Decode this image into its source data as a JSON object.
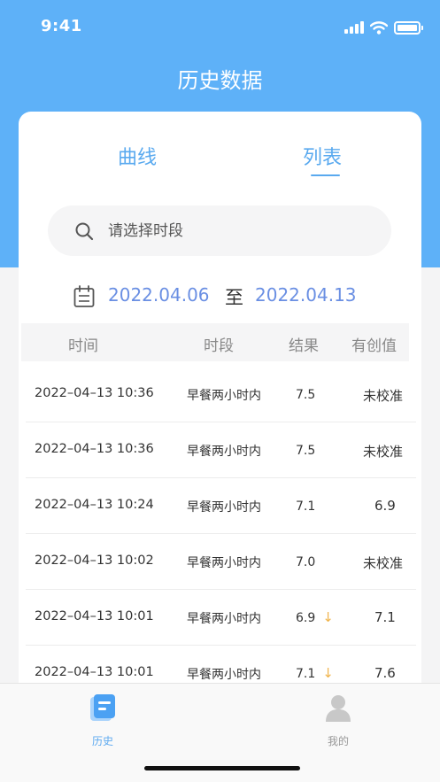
{
  "status_bar": {
    "time": "9:41"
  },
  "header": {
    "title": "历史数据"
  },
  "tabs": {
    "curve": "曲线",
    "list": "列表",
    "active": "列表"
  },
  "search": {
    "placeholder": "请选择时段"
  },
  "date_range": {
    "start": "2022.04.06",
    "separator": "至",
    "end": "2022.04.13"
  },
  "table": {
    "headers": {
      "time": "时间",
      "period": "时段",
      "result": "结果",
      "calibration": "有创值"
    },
    "rows": [
      {
        "time": "2022–04–13 10:36",
        "period": "早餐两小时内",
        "result": "7.5",
        "trend": "",
        "calibration": "未校准"
      },
      {
        "time": "2022–04–13 10:36",
        "period": "早餐两小时内",
        "result": "7.5",
        "trend": "",
        "calibration": "未校准"
      },
      {
        "time": "2022–04–13 10:24",
        "period": "早餐两小时内",
        "result": "7.1",
        "trend": "",
        "calibration": "6.9"
      },
      {
        "time": "2022–04–13 10:02",
        "period": "早餐两小时内",
        "result": "7.0",
        "trend": "",
        "calibration": "未校准"
      },
      {
        "time": "2022–04–13 10:01",
        "period": "早餐两小时内",
        "result": "6.9",
        "trend": "↓",
        "calibration": "7.1"
      },
      {
        "time": "2022–04–13 10:01",
        "period": "早餐两小时内",
        "result": "7.1",
        "trend": "↓",
        "calibration": "7.6"
      }
    ]
  },
  "tab_bar": {
    "history": {
      "label": "历史",
      "icon": "history-doc-icon"
    },
    "mine": {
      "label": "我的",
      "icon": "user-avatar-icon"
    }
  },
  "colors": {
    "primary": "#5eb1f8",
    "accent_text": "#6a8fe3",
    "arrow": "#f0b44c"
  }
}
